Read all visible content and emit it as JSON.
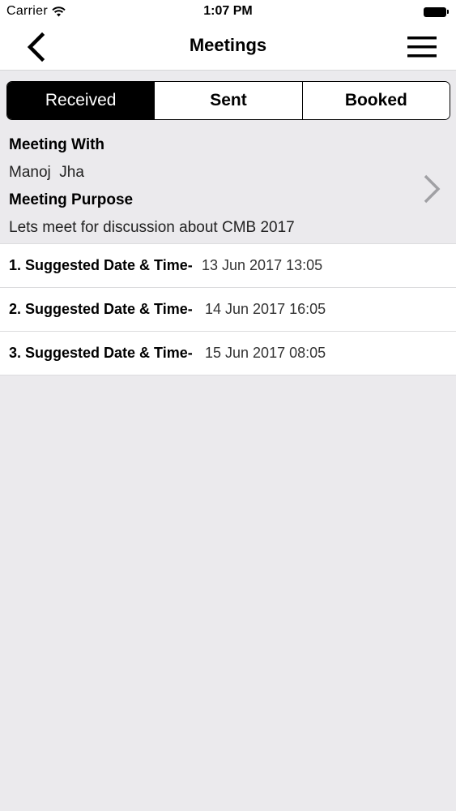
{
  "status_bar": {
    "carrier": "Carrier",
    "time": "1:07 PM"
  },
  "nav": {
    "title": "Meetings",
    "back_icon": "chevron-left-icon",
    "menu_icon": "hamburger-menu-icon"
  },
  "tabs": [
    {
      "label": "Received",
      "active": true
    },
    {
      "label": "Sent",
      "active": false
    },
    {
      "label": "Booked",
      "active": false
    }
  ],
  "meeting": {
    "with_label": "Meeting With",
    "with_value": "Manoj  Jha",
    "purpose_label": "Meeting Purpose",
    "purpose_value": "Lets meet for discussion about CMB 2017"
  },
  "suggestions": [
    {
      "label": "1. Suggested Date & Time-",
      "value": "13 Jun 2017 13:05"
    },
    {
      "label": "2. Suggested Date & Time-",
      "value": "14 Jun 2017 16:05"
    },
    {
      "label": "3. Suggested Date & Time-",
      "value": "15 Jun 2017 08:05"
    }
  ],
  "colors": {
    "background": "#ebeaed",
    "accent": "#000000",
    "chevron": "#a0a0a4"
  }
}
